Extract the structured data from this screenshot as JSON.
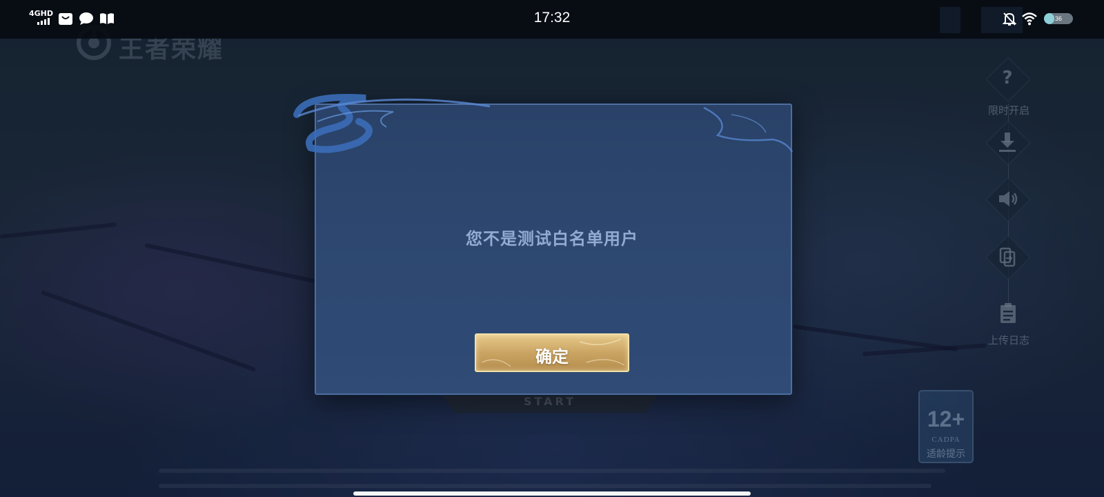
{
  "status_bar": {
    "network": "4GHD",
    "time": "17:32",
    "battery_level": "36",
    "battery_fraction": 0.36,
    "icons": [
      "signal-bars-icon",
      "mail-bag-icon",
      "chat-bubble-icon",
      "book-icon",
      "bell-off-icon",
      "wifi-icon",
      "battery-icon"
    ]
  },
  "game": {
    "logo_text": "王者荣耀",
    "start_button_label": "START",
    "side_tools": [
      {
        "icon": "question-icon",
        "label": "限时开启"
      },
      {
        "icon": "download-icon",
        "label": ""
      },
      {
        "icon": "speaker-icon",
        "label": ""
      },
      {
        "icon": "switch-account-icon",
        "label": ""
      },
      {
        "icon": "clipboard-icon",
        "label": "上传日志"
      }
    ],
    "age_rating": {
      "number": "12+",
      "org": "CADPA",
      "tip": "适龄提示"
    }
  },
  "dialog": {
    "message": "您不是测试白名单用户",
    "confirm_label": "确定"
  },
  "colors": {
    "dialog_bg": "#2d4770",
    "dialog_border": "#4e6e9e",
    "message_text": "#93abd2",
    "button_gold": "#caa463"
  }
}
